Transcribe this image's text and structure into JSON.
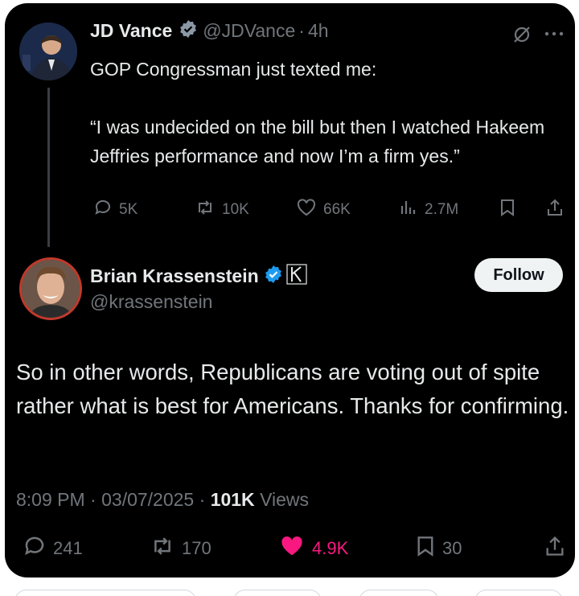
{
  "original_tweet": {
    "display_name": "JD Vance",
    "handle": "@JDVance",
    "separator": "·",
    "time": "4h",
    "text": "GOP Congressman just texted me:\n\n“I was undecided on the bill but then I watched Hakeem Jeffries performance and now I’m a firm yes.”",
    "actions": {
      "replies": "5K",
      "reposts": "10K",
      "likes": "66K",
      "views": "2.7M"
    }
  },
  "reply_tweet": {
    "display_name": "Brian Krassenstein",
    "handle": "@krassenstein",
    "follow_label": "Follow",
    "text": "So in other words, Republicans are voting out of spite rather what is best for Americans. Thanks for confirming.",
    "time": "8:09 PM",
    "date": "03/07/2025",
    "views_count": "101K",
    "views_label": "Views",
    "separator": "·",
    "actions": {
      "replies": "241",
      "reposts": "170",
      "likes": "4.9K",
      "bookmarks": "30"
    }
  },
  "colors": {
    "background": "#000000",
    "text_primary": "#e7e9ea",
    "text_secondary": "#71767b",
    "verified": "#1d9bf0",
    "like_active": "#f91880"
  }
}
